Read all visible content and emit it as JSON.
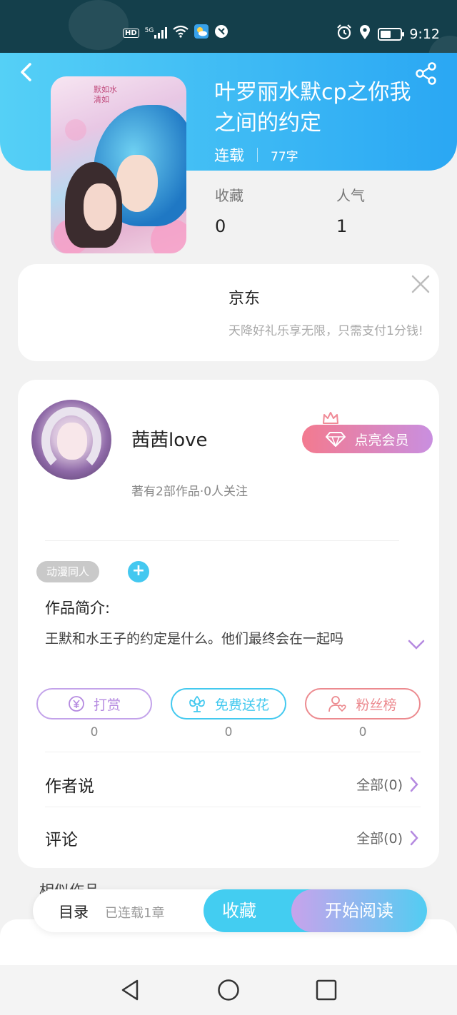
{
  "status_bar": {
    "hd": "HD",
    "network": "5G",
    "time": "9:12"
  },
  "book": {
    "title": "叶罗丽水默cp之你我之间的约定",
    "status": "连载",
    "word_count": "77字",
    "cover_text": "默如水 清如",
    "stats": [
      {
        "label": "收藏",
        "value": "0"
      },
      {
        "label": "人气",
        "value": "1"
      }
    ]
  },
  "ad": {
    "brand": "京东",
    "description": "天降好礼乐享无限，只需支付1分钱!"
  },
  "author": {
    "name": "茜茜love",
    "meta": "著有2部作品·0人关注",
    "vip_button": "点亮会员"
  },
  "tags": [
    "动漫同人"
  ],
  "tag_add": "+",
  "intro": {
    "label": "作品简介:",
    "text": "王默和水王子的约定是什么。他们最终会在一起吗"
  },
  "actions": [
    {
      "label": "打赏",
      "count": "0",
      "color": "#b58ae0"
    },
    {
      "label": "免费送花",
      "count": "0",
      "color": "#43c9ef"
    },
    {
      "label": "粉丝榜",
      "count": "0",
      "color": "#ec8a8f"
    }
  ],
  "rows": [
    {
      "label": "作者说",
      "right": "全部(0)"
    },
    {
      "label": "评论",
      "right": "全部(0)"
    }
  ],
  "similar_peek": "相似作品",
  "bottom_bar": {
    "catalog": "目录",
    "chapter_count": "已连载1章",
    "collect": "收藏",
    "start_reading": "开始阅读"
  },
  "colors": {
    "header_start": "#55d0f6",
    "header_end": "#2aa7f3",
    "accent": "#43cdf1",
    "vip_start": "#f37a8f",
    "vip_end": "#c98fe0"
  }
}
